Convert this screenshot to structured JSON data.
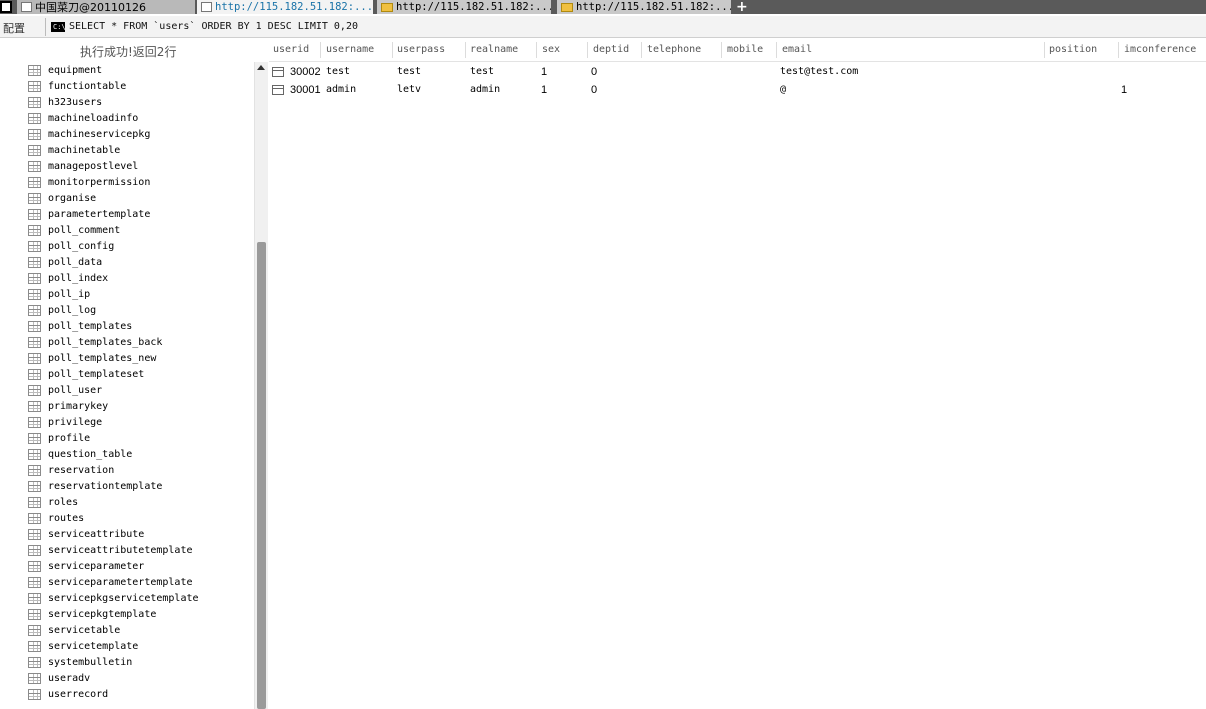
{
  "tabs": {
    "main_label": "中国菜刀@20110126",
    "active_label": "http://115.182.51.182:...",
    "tab3_label": "http://115.182.51.182:...",
    "tab4_label": "http://115.182.51.182:...",
    "new_tab_symbol": "+"
  },
  "sqlbar": {
    "config_label": "配置",
    "query": "SELECT * FROM `users` ORDER BY 1 DESC LIMIT 0,20"
  },
  "status": "执行成功!返回2行",
  "tree": {
    "items": [
      "equipment",
      "functiontable",
      "h323users",
      "machineloadinfo",
      "machineservicepkg",
      "machinetable",
      "managepostlevel",
      "monitorpermission",
      "organise",
      "parametertemplate",
      "poll_comment",
      "poll_config",
      "poll_data",
      "poll_index",
      "poll_ip",
      "poll_log",
      "poll_templates",
      "poll_templates_back",
      "poll_templates_new",
      "poll_templateset",
      "poll_user",
      "primarykey",
      "privilege",
      "profile",
      "question_table",
      "reservation",
      "reservationtemplate",
      "roles",
      "routes",
      "serviceattribute",
      "serviceattributetemplate",
      "serviceparameter",
      "serviceparametertemplate",
      "servicepkgservicetemplate",
      "servicepkgtemplate",
      "servicetable",
      "servicetemplate",
      "systembulletin",
      "useradv",
      "userrecord"
    ]
  },
  "grid": {
    "columns": [
      "userid",
      "username",
      "userpass",
      "realname",
      "sex",
      "deptid",
      "telephone",
      "mobile",
      "email",
      "position",
      "imconference"
    ],
    "rows": [
      {
        "userid": "30002",
        "username": "test",
        "userpass": "test",
        "realname": "test",
        "sex": "1",
        "deptid": "0",
        "telephone": "",
        "mobile": "",
        "email": "test@test.com",
        "position": "",
        "imconference": ""
      },
      {
        "userid": "30001",
        "username": "admin",
        "userpass": "letv",
        "realname": "admin",
        "sex": "1",
        "deptid": "0",
        "telephone": "",
        "mobile": "",
        "email": "@",
        "position": "",
        "imconference": "1"
      }
    ]
  },
  "icons": {
    "app": "app-window-icon",
    "page": "page-icon",
    "folder": "folder-icon",
    "table": "table-icon",
    "row": "row-icon",
    "command": "command-prompt-icon"
  }
}
